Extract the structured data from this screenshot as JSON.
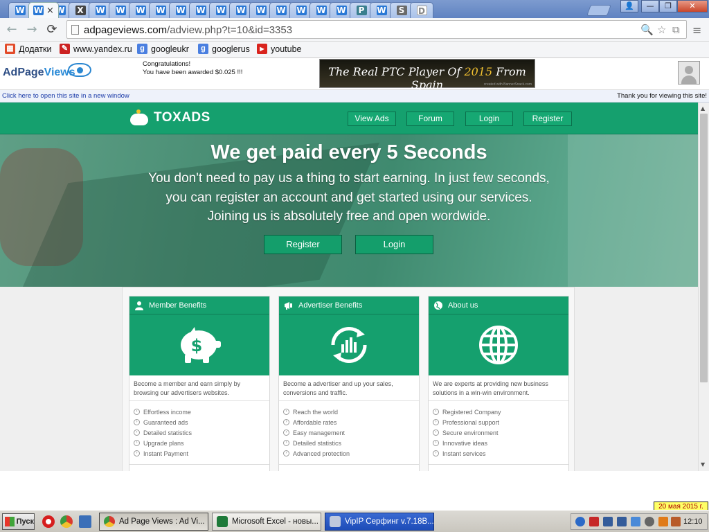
{
  "browser": {
    "tabs": [
      {
        "icon": "W"
      },
      {
        "icon": "W",
        "active": true
      },
      {
        "icon": "W"
      },
      {
        "icon": "X"
      },
      {
        "icon": "W"
      },
      {
        "icon": "W"
      },
      {
        "icon": "W"
      },
      {
        "icon": "W"
      },
      {
        "icon": "W"
      },
      {
        "icon": "W"
      },
      {
        "icon": "W"
      },
      {
        "icon": "W"
      },
      {
        "icon": "W"
      },
      {
        "icon": "W"
      },
      {
        "icon": "W"
      },
      {
        "icon": "W"
      },
      {
        "icon": "W"
      },
      {
        "icon": "P"
      },
      {
        "icon": "W"
      },
      {
        "icon": "S"
      },
      {
        "icon": "D"
      }
    ],
    "active_tab_close": "×",
    "window_controls": {
      "user": "👤",
      "minimize": "—",
      "maximize": "❐",
      "close": "✕"
    },
    "nav": {
      "back": "←",
      "forward": "→",
      "reload": "⟳"
    },
    "url_domain": "adpageviews.com",
    "url_path": "/adview.php?t=10&id=3353",
    "omnibox_icons": {
      "search": "🔍",
      "star": "☆",
      "ext": "⧉"
    },
    "menu_icon": "≡",
    "bookmarks": [
      {
        "label": "Додатки",
        "icon": "apps-icon",
        "color": "#e24b2a"
      },
      {
        "label": "www.yandex.ru",
        "icon": "yandex-icon",
        "color": "#cc2222"
      },
      {
        "label": "googleukr",
        "icon": "google-icon",
        "color": "#4a7fe0"
      },
      {
        "label": "googlerus",
        "icon": "google-icon",
        "color": "#4a7fe0"
      },
      {
        "label": "youtube",
        "icon": "youtube-icon",
        "color": "#d9231d"
      }
    ],
    "bookmark_glyphs": [
      "▦",
      "✎",
      "g",
      "g",
      "▶"
    ]
  },
  "adpageviews": {
    "logo_part1": "AdPage",
    "logo_part2": "Views",
    "congrats_line1": "Congratulations!",
    "congrats_line2": "You have been awarded $0.025 !!!",
    "banner_part1": "The Real PTC Player Of ",
    "banner_year": "2015",
    "banner_part2": " From Spain",
    "banner_credit": "created with BannerSnack.com",
    "open_link": "Click here to open this site in a new window",
    "thank_you": "Thank you for viewing this site!"
  },
  "site": {
    "brand": "TOXADS",
    "nav": [
      "View Ads",
      "Forum",
      "Login",
      "Register"
    ],
    "hero_title": "We get paid every 5 Seconds",
    "hero_text_1": "You don't need to pay us a thing to start earning. In just few seconds,",
    "hero_text_2": "you can register an account and get started using our services.",
    "hero_text_3": "Joining us is absolutely free and open wordwide.",
    "hero_register": "Register",
    "hero_login": "Login",
    "cards": [
      {
        "title": "Member Benefits",
        "icon": "piggy-bank-icon",
        "desc": "Become a member and earn simply by browsing our advertisers websites.",
        "items": [
          "Effortless income",
          "Guaranteed ads",
          "Detailed statistics",
          "Upgrade plans",
          "Instant Payment"
        ]
      },
      {
        "title": "Advertiser Benefits",
        "icon": "chart-refresh-icon",
        "desc": "Become a advertiser and up your sales, conversions and traffic.",
        "items": [
          "Reach the world",
          "Affordable rates",
          "Easy management",
          "Detailed statistics",
          "Advanced protection"
        ]
      },
      {
        "title": "About us",
        "icon": "globe-icon",
        "desc": "We are experts at providing new business solutions in a win-win environment.",
        "items": [
          "Registered Company",
          "Professional support",
          "Secure environment",
          "Innovative ideas",
          "Instant services"
        ]
      }
    ]
  },
  "taskbar": {
    "start": "Пуск",
    "tasks": [
      "Ad Page Views : Ad Vi...",
      "Microsoft Excel - новы...",
      "VipIP Серфинг  v.7.18B..."
    ],
    "clock": "12:10",
    "date_tooltip": "20 мая 2015 г."
  }
}
